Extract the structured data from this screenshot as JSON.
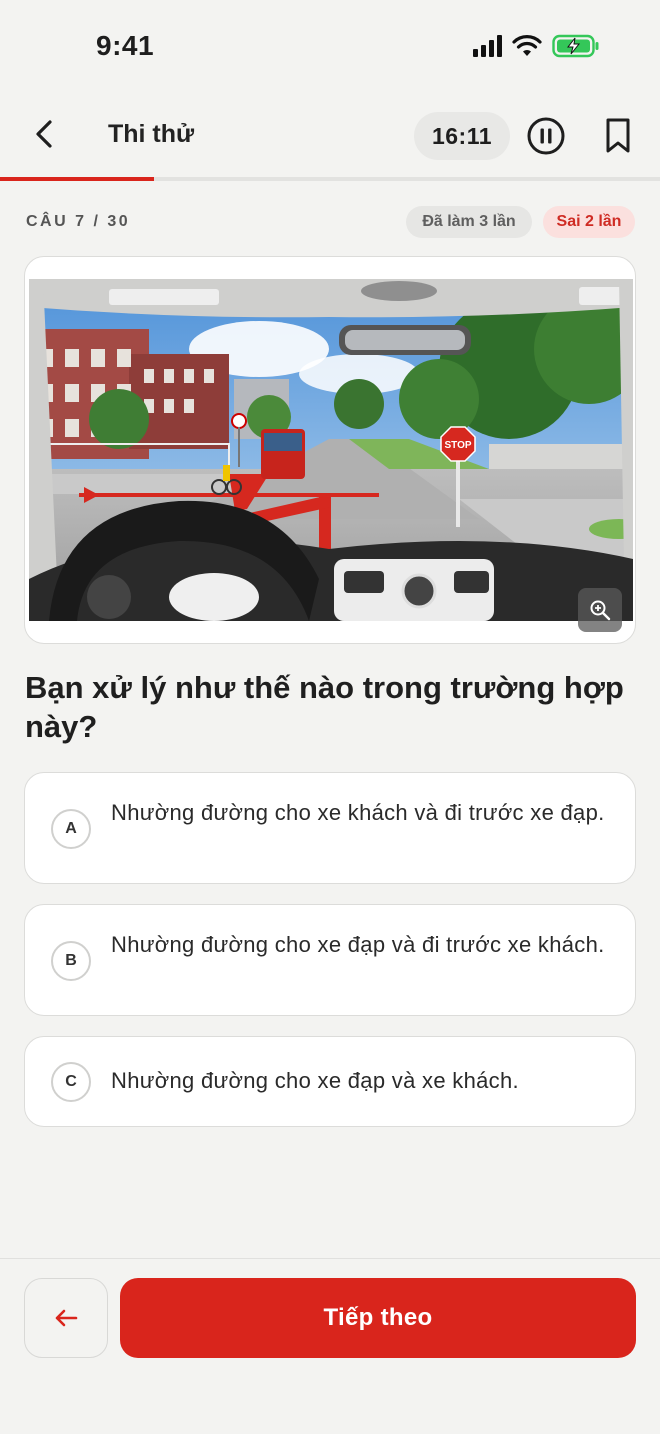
{
  "status_bar": {
    "time": "9:41",
    "colors": {
      "battery": "#34c759"
    }
  },
  "header": {
    "title": "Thi thử",
    "timer": "16:11"
  },
  "progress": {
    "current": 7,
    "total": 30,
    "fraction": 0.2333,
    "color": "#d9251c"
  },
  "meta": {
    "counter_label": "CÂU 7 / 30",
    "attempts_badge": "Đã làm 3 lần",
    "wrong_badge": "Sai 2 lần"
  },
  "illustration": {
    "sign_text": "STOP",
    "icons": [
      "zoom-in-icon"
    ]
  },
  "question": {
    "text": "Bạn xử lý như thế nào trong trường hợp này?"
  },
  "options": [
    {
      "letter": "A",
      "text": "Nhường đường cho xe khách và đi trước xe đạp."
    },
    {
      "letter": "B",
      "text": "Nhường đường cho xe đạp và đi trước xe khách."
    },
    {
      "letter": "C",
      "text": "Nhường đường cho xe đạp và xe khách."
    }
  ],
  "footer": {
    "next_label": "Tiếp theo",
    "icons": [
      "arrow-left-icon"
    ],
    "accent": "#d9251c"
  }
}
